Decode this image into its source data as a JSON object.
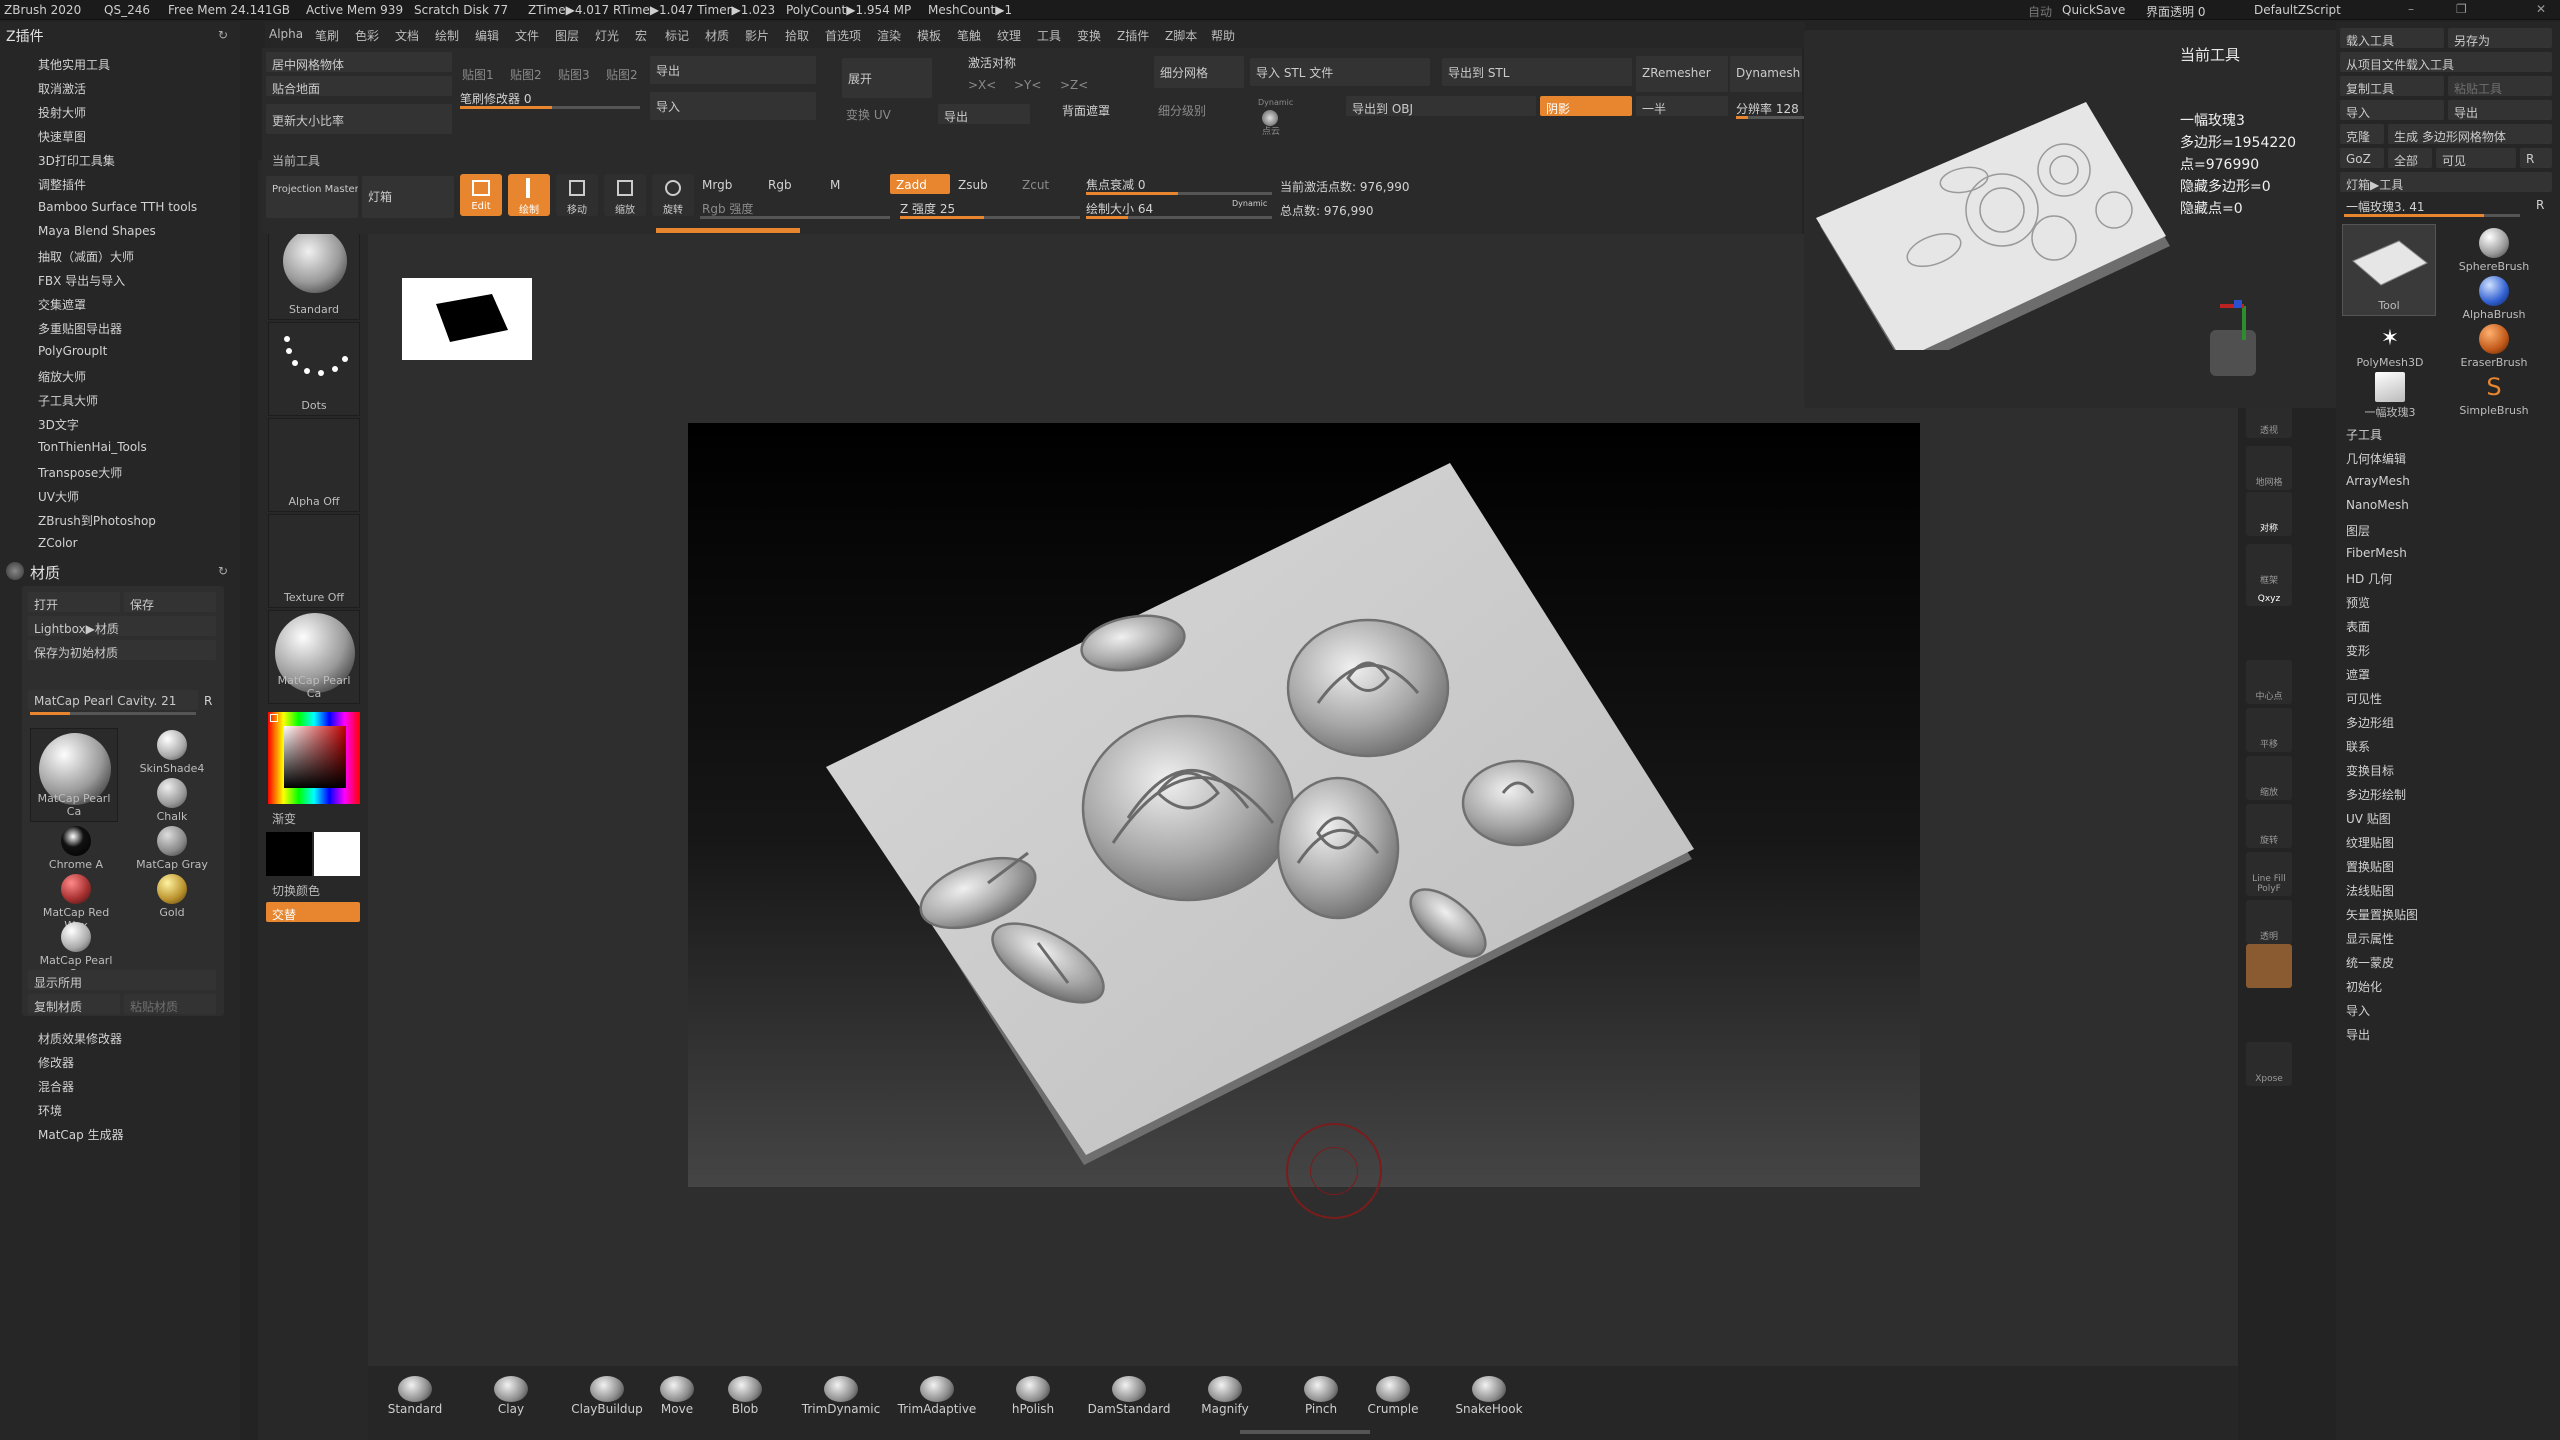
{
  "title_bar": {
    "app": "ZBrush 2020",
    "doc": "QS_246",
    "stats": [
      "Free Mem 24.141GB",
      "Active Mem 939",
      "Scratch Disk 77",
      "ZTime▶4.017 RTime▶1.047 Timer▶1.023",
      "PolyCount▶1.954 MP",
      "MeshCount▶1"
    ],
    "auto_label": "自动",
    "quicksave": "QuickSave",
    "ui_opacity": "界面透明 0",
    "script": "DefaultZScript"
  },
  "menu": [
    "Alpha",
    "笔刷",
    "色彩",
    "文档",
    "绘制",
    "编辑",
    "文件",
    "图层",
    "灯光",
    "宏",
    "标记",
    "材质",
    "影片",
    "拾取",
    "首选项",
    "渲染",
    "模板",
    "笔触",
    "纹理",
    "工具",
    "变换",
    "Z插件",
    "Z脚本",
    "帮助"
  ],
  "zplugin": {
    "title": "Z插件",
    "items": [
      "其他实用工具",
      "取消激活",
      "投射大师",
      "快速草图",
      "3D打印工具集",
      "调整插件",
      "Bamboo Surface TTH tools",
      "Maya Blend Shapes",
      "抽取（减面）大师",
      "FBX 导出与导入",
      "交集遮罩",
      "多重贴图导出器",
      "PolyGroupIt",
      "缩放大师",
      "子工具大师",
      "3D文字",
      "TonThienHai_Tools",
      "Transpose大师",
      "UV大师",
      "ZBrush到Photoshop",
      "ZColor"
    ]
  },
  "material": {
    "title": "材质",
    "open": "打开",
    "save": "保存",
    "lightbox": "Lightbox▶材质",
    "save_init": "保存为初始材质",
    "current": "MatCap Pearl Cavity. 21",
    "r": "R",
    "big_name": "MatCap Pearl Ca",
    "items": [
      "SkinShade4",
      "Chalk",
      "MatCap Gray",
      "Gold",
      "Chrome A",
      "MatCap Red Wax",
      "MatCap Pearl Ca"
    ],
    "show_used": "显示所用",
    "copy": "复制材质",
    "paste": "粘贴材质",
    "extras": [
      "材质效果修改器",
      "修改器",
      "混合器",
      "环境",
      "MatCap 生成器"
    ]
  },
  "top": {
    "center_mesh": "居中网格物体",
    "stick_floor": "贴合地面",
    "update_ratio": "更新大小比率",
    "stamp_labels": [
      "贴图1",
      "贴图2",
      "贴图3",
      "贴图2"
    ],
    "brush_mod": "笔刷修改器 0",
    "export": "导出",
    "import": "导入",
    "unfold": "展开",
    "transform_uv": "变换 UV",
    "export2": "导出",
    "activate_sym": "激活对称",
    "x": ">X<",
    "y": ">Y<",
    "z": ">Z<",
    "back_mask": "背面遮罩",
    "subdiv": "细分网格",
    "subdiv_level": "细分级别",
    "dynamic": "Dynamic",
    "point": "点云",
    "import_stl": "导入 STL 文件",
    "export_stl": "导出到 STL",
    "export_obj": "导出到 OBJ",
    "shadow": "阴影",
    "zremesher": "ZRemesher",
    "half": "一半",
    "dynamesh": "Dynamesh",
    "resolution": "分辨率 128",
    "current_tool_lbl": "当前工具"
  },
  "tools_row": {
    "projection_master": "Projection Master",
    "lightbox": "灯箱",
    "edit": "Edit",
    "draw": "绘制",
    "move": "移动",
    "scale": "缩放",
    "rotate": "旋转",
    "mrgb": "Mrgb",
    "rgb": "Rgb",
    "m": "M",
    "rgb_intensity": "Rgb 强度",
    "zadd": "Zadd",
    "zsub": "Zsub",
    "zcut": "Zcut",
    "z_intensity": "Z 强度 25",
    "focal_shift": "焦点衰减 0",
    "draw_size": "绘制大小 64",
    "dynamic": "Dynamic",
    "active_points": "当前激活点数: 976,990",
    "total_points": "总点数: 976,990"
  },
  "left_tray": {
    "brush": "Standard",
    "stroke": "Dots",
    "alpha": "Alpha Off",
    "texture": "Texture Off",
    "material": "MatCap Pearl Ca",
    "gradient": "渐变",
    "switch_color": "切换颜色",
    "alternate": "交替"
  },
  "tool_preview": {
    "title": "当前工具",
    "name": "一幅玫瑰3",
    "polys": "多边形=1954220",
    "points": "点=976990",
    "hidden_polys": "隐藏多边形=0",
    "hidden_points": "隐藏点=0"
  },
  "right_panel": {
    "load_tool": "载入工具",
    "save_as": "另存为",
    "load_from_project": "从项目文件载入工具",
    "copy_tool": "复制工具",
    "paste_tool": "粘贴工具",
    "import": "导入",
    "export": "导出",
    "clone": "克隆",
    "make_polymesh": "生成 多边形网格物体",
    "goz": "GoZ",
    "all": "全部",
    "visible": "可见",
    "r": "R",
    "lightbox_tool": "灯箱▶工具",
    "current": "一幅玫瑰3. 41",
    "tools": [
      "Tool",
      "SphereBrush",
      "AlphaBrush",
      "PolyMesh3D",
      "EraserBrush",
      "一幅玫瑰3",
      "SimpleBrush"
    ],
    "sections": [
      "子工具",
      "几何体编辑",
      "ArrayMesh",
      "NanoMesh",
      "图层",
      "FiberMesh",
      "HD 几何",
      "预览",
      "表面",
      "变形",
      "遮罩",
      "可见性",
      "多边形组",
      "联系",
      "变换目标",
      "多边形绘制",
      "UV 贴图",
      "纹理贴图",
      "置换贴图",
      "法线贴图",
      "矢量置换贴图",
      "显示属性",
      "统一蒙皮",
      "初始化",
      "导入",
      "导出"
    ]
  },
  "shelf": [
    "透视",
    "地网格",
    "对称",
    "框架",
    "Qxyz",
    "中心点",
    "平移",
    "缩放",
    "旋转",
    "Line Fill PolyF",
    "透明",
    "Xpose"
  ],
  "brushes": [
    "Standard",
    "Clay",
    "ClayBuildup",
    "Move",
    "Blob",
    "TrimDynamic",
    "TrimAdaptive",
    "hPolish",
    "DamStandard",
    "Magnify",
    "Pinch",
    "Crumple",
    "SnakeHook"
  ],
  "colors": {
    "accent": "#e8862f",
    "background": "#232323"
  }
}
